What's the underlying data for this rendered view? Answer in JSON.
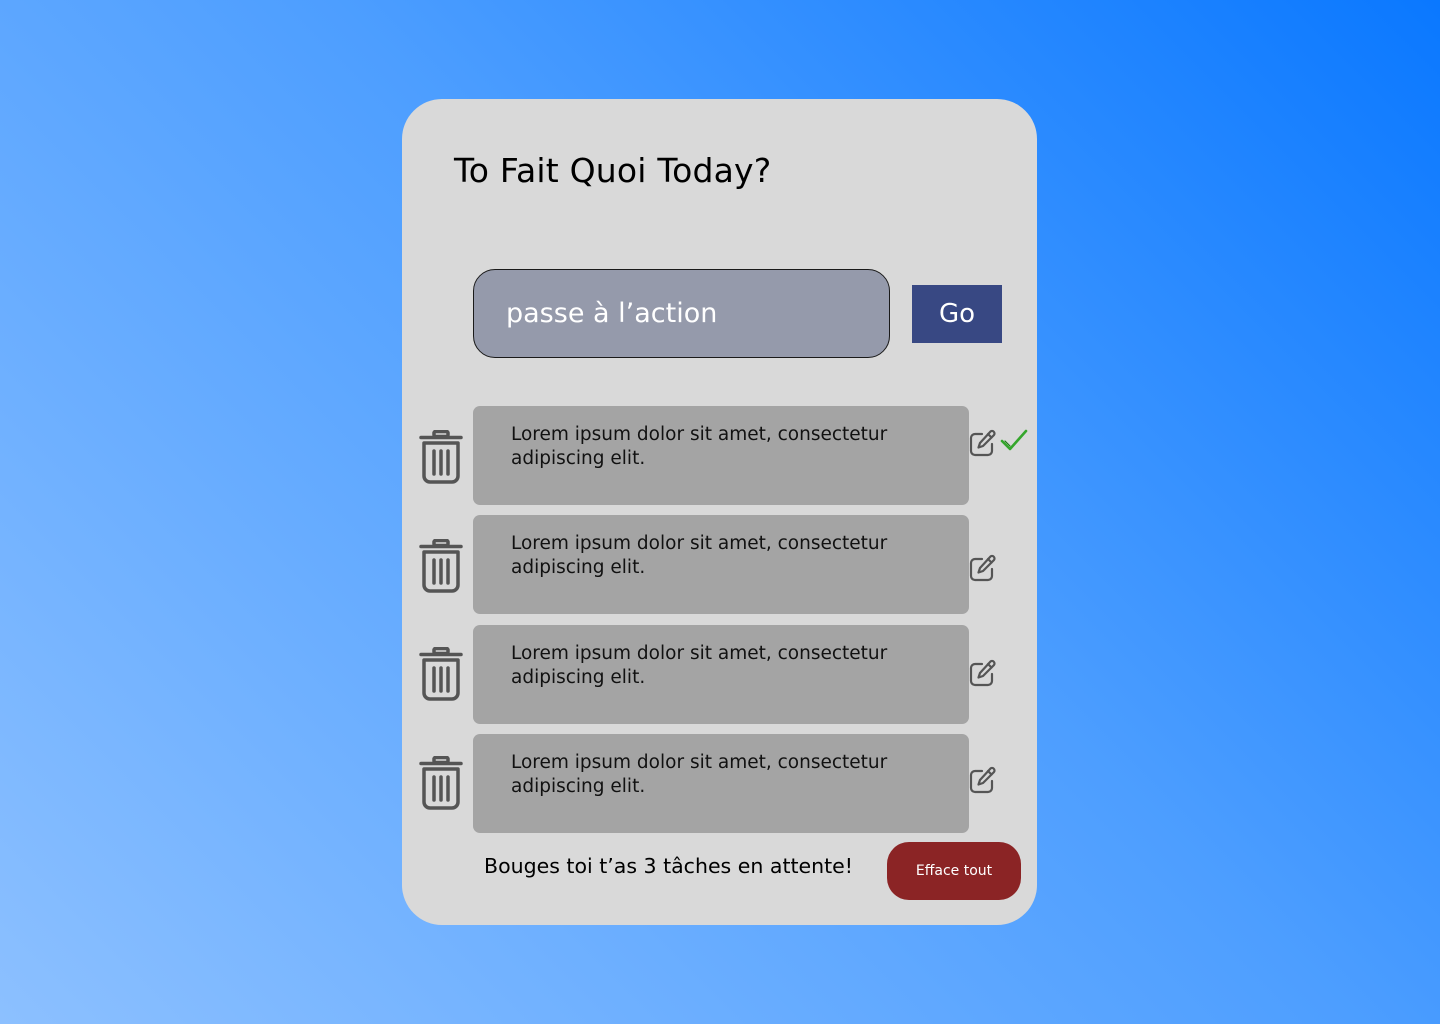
{
  "app": {
    "title": "To Fait Quoi Today?"
  },
  "input": {
    "placeholder": "passe à l’action",
    "value": ""
  },
  "go_button": {
    "label": "Go"
  },
  "tasks": [
    {
      "text": "Lorem ipsum dolor sit amet, consectetur adipiscing elit.",
      "completed": true
    },
    {
      "text": "Lorem ipsum dolor sit amet, consectetur adipiscing elit.",
      "completed": false
    },
    {
      "text": "Lorem ipsum dolor sit amet, consectetur adipiscing elit.",
      "completed": false
    },
    {
      "text": "Lorem ipsum dolor sit amet, consectetur adipiscing elit.",
      "completed": false
    }
  ],
  "footer": {
    "pending_text": "Bouges toi t’as 3 tâches en attente!",
    "clear_button_label": "Efface tout"
  },
  "icons": {
    "delete": "trash-icon",
    "edit": "pencil-square-icon",
    "done": "checkmark-icon"
  },
  "colors": {
    "card_background": "#d9d9d9",
    "input_background": "#959aab",
    "go_button": "#384883",
    "task_background": "#a4a4a4",
    "clear_button": "#8b2425",
    "check_accent": "#35a62c",
    "icon_gray": "#555555"
  }
}
